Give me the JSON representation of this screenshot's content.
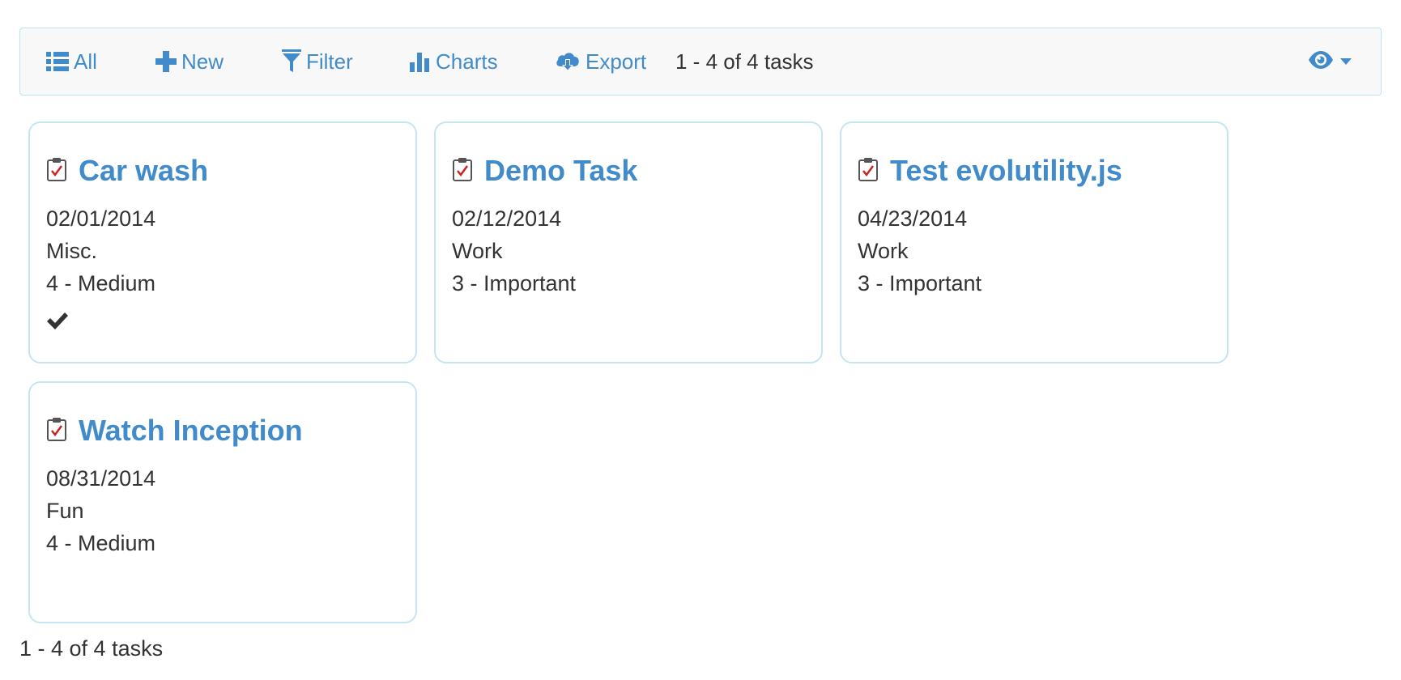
{
  "toolbar": {
    "buttons": [
      {
        "label": "All",
        "icon": "list-icon"
      },
      {
        "label": "New",
        "icon": "plus-icon"
      },
      {
        "label": "Filter",
        "icon": "filter-icon"
      },
      {
        "label": "Charts",
        "icon": "bar-chart-icon"
      },
      {
        "label": "Export",
        "icon": "cloud-download-icon"
      }
    ],
    "count_text": "1 - 4 of 4 tasks",
    "view_menu_icon": "eye-icon"
  },
  "tasks": [
    {
      "title": "Car wash",
      "date": "02/01/2014",
      "category": "Misc.",
      "priority": "4 - Medium",
      "complete": true
    },
    {
      "title": "Demo Task",
      "date": "02/12/2014",
      "category": "Work",
      "priority": "3 - Important",
      "complete": false
    },
    {
      "title": "Test evolutility.js",
      "date": "04/23/2014",
      "category": "Work",
      "priority": "3 - Important",
      "complete": false
    },
    {
      "title": "Watch Inception",
      "date": "08/31/2014",
      "category": "Fun",
      "priority": "4 - Medium",
      "complete": false
    }
  ],
  "footer": {
    "count_text": "1 - 4 of 4 tasks"
  },
  "colors": {
    "accent": "#428bca",
    "text": "#333333",
    "card_border": "#c4e6f1",
    "toolbar_bg": "#f8f8f8",
    "clipboard_check": "#cc2222"
  }
}
